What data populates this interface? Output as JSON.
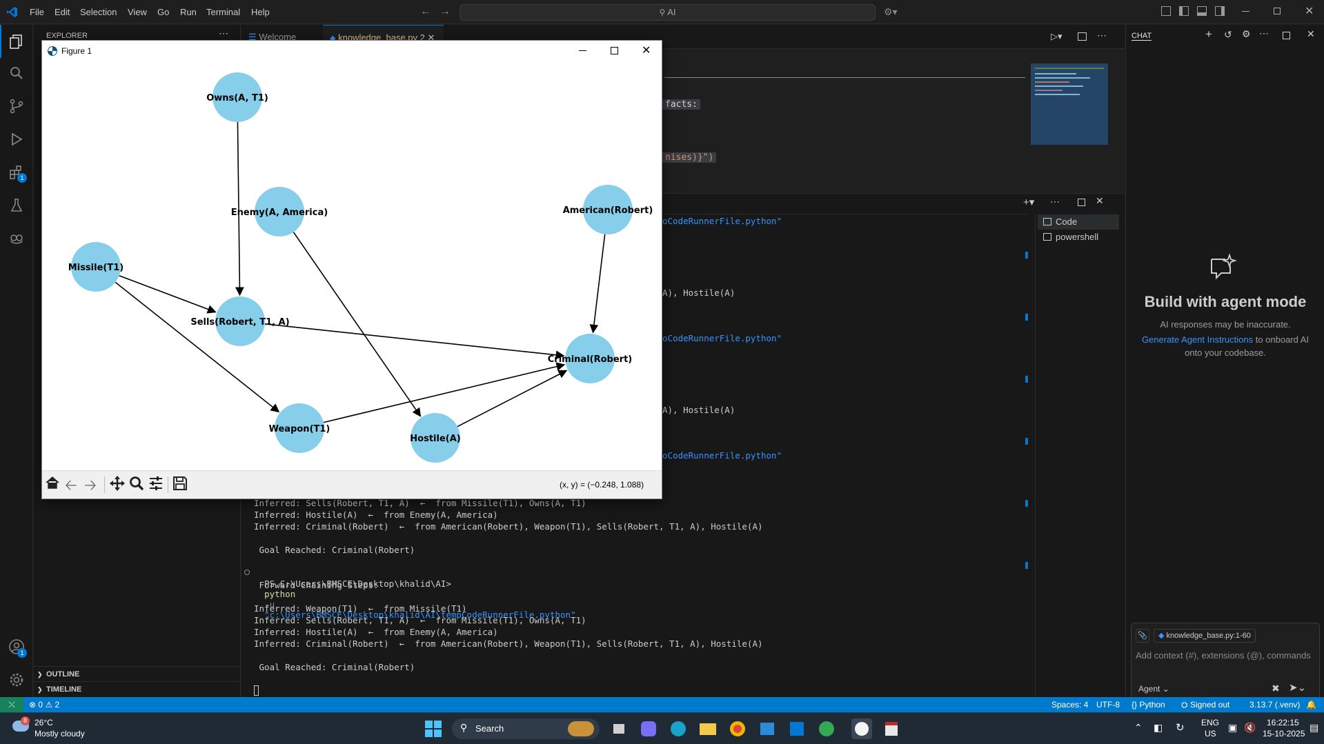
{
  "menubar": [
    "File",
    "Edit",
    "Selection",
    "View",
    "Go",
    "Run",
    "Terminal",
    "Help"
  ],
  "command_center": {
    "placeholder": "AI"
  },
  "sidebar": {
    "title": "EXPLORER",
    "outline": "OUTLINE",
    "timeline": "TIMELINE"
  },
  "tabs": [
    {
      "label": "Welcome"
    },
    {
      "label": "knowledge_base.py",
      "dirty": "2"
    }
  ],
  "editor_snippets": [
    "facts:",
    "nises)}\")"
  ],
  "figure": {
    "title": "Figure 1",
    "coords": "(x, y) = (−0.248, 1.088)",
    "nodes": [
      {
        "label": "Owns(A, T1)"
      },
      {
        "label": "Enemy(A, America)"
      },
      {
        "label": "American(Robert)"
      },
      {
        "label": "Missile(T1)"
      },
      {
        "label": "Sells(Robert, T1, A)"
      },
      {
        "label": "Criminal(Robert)"
      },
      {
        "label": "Weapon(T1)"
      },
      {
        "label": "Hostile(A)"
      }
    ],
    "edges": [
      [
        "Owns(A, T1)",
        "Sells(Robert, T1, A)"
      ],
      [
        "Missile(T1)",
        "Sells(Robert, T1, A)"
      ],
      [
        "Missile(T1)",
        "Weapon(T1)"
      ],
      [
        "Enemy(A, America)",
        "Hostile(A)"
      ],
      [
        "American(Robert)",
        "Criminal(Robert)"
      ],
      [
        "Sells(Robert, T1, A)",
        "Criminal(Robert)"
      ],
      [
        "Weapon(T1)",
        "Criminal(Robert)"
      ],
      [
        "Hostile(A)",
        "Criminal(Robert)"
      ]
    ],
    "node_color": "#87ceeb"
  },
  "terminal": {
    "partial_lines": [
      "oCodeRunnerFile.python\"",
      "A), Hostile(A)",
      "oCodeRunnerFile.python\"",
      "A), Hostile(A)",
      "oCodeRunnerFile.python\""
    ],
    "lines_before": [
      "Inferred: Sells(Robert, T1, A)  ←  from Missile(T1), Owns(A, T1)",
      "Inferred: Hostile(A)  ←  from Enemy(A, America)",
      "Inferred: Criminal(Robert)  ←  from American(Robert), Weapon(T1), Sells(Robert, T1, A), Hostile(A)",
      "",
      " Goal Reached: Criminal(Robert)"
    ],
    "prompt": "PS C:\\Users\\BMSCE\\Desktop\\khalid\\AI>",
    "command": "python",
    "flag": "-u",
    "path": "\"c:\\Users\\BMSCE\\Desktop\\khalid\\AI\\tempCodeRunnerFile.python\"",
    "lines_after": [
      " Forward Chaining Steps:",
      "",
      "Inferred: Weapon(T1)  ←  from Missile(T1)",
      "Inferred: Sells(Robert, T1, A)  ←  from Missile(T1), Owns(A, T1)",
      "Inferred: Hostile(A)  ←  from Enemy(A, America)",
      "Inferred: Criminal(Robert)  ←  from American(Robert), Weapon(T1), Sells(Robert, T1, A), Hostile(A)",
      "",
      " Goal Reached: Criminal(Robert)"
    ],
    "sessions": [
      "Code",
      "powershell"
    ]
  },
  "chat": {
    "header": "CHAT",
    "heading": "Build with agent mode",
    "note": "AI responses may be inaccurate.",
    "link": "Generate Agent Instructions",
    "link_tail": "to onboard AI",
    "tail2": "onto your codebase.",
    "context_file": "knowledge_base.py:1-60",
    "input_placeholder": "Add context (#), extensions (@), commands",
    "mode": "Agent"
  },
  "statusbar": {
    "errors": "0",
    "warnings": "2",
    "spaces": "Spaces: 4",
    "encoding": "UTF-8",
    "language": "Python",
    "account": "Signed out",
    "interpreter": "3.13.7 (.venv)"
  },
  "taskbar": {
    "weather_badge": "8",
    "temp": "26°C",
    "condition": "Mostly cloudy",
    "search": "Search",
    "lang1": "ENG",
    "lang2": "US",
    "time": "16:22:15",
    "date": "15-10-2025"
  }
}
